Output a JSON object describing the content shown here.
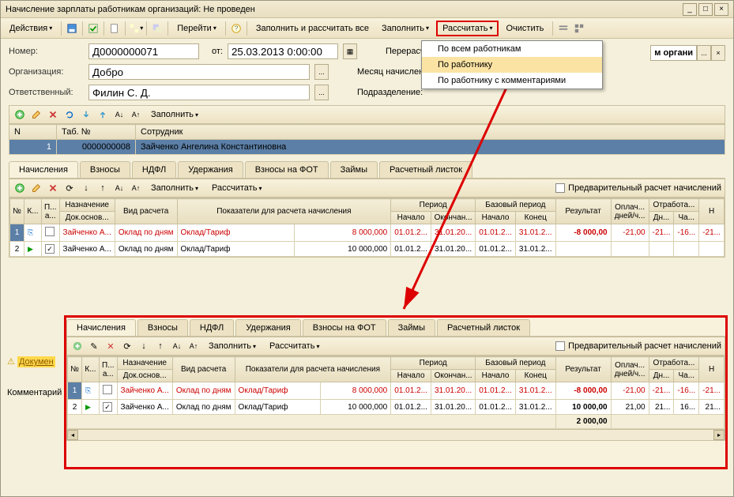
{
  "window": {
    "title": "Начисление зарплаты работникам организаций: Не проведен",
    "min": "_",
    "max": "□",
    "close": "×"
  },
  "toolbar": {
    "actions": "Действия",
    "goto": "Перейти",
    "help": "?",
    "fill_calc_all": "Заполнить и рассчитать все",
    "fill": "Заполнить",
    "calculate": "Рассчитать",
    "clear": "Очистить"
  },
  "menu": {
    "item1": "По всем работникам",
    "item2": "По работнику",
    "item3": "По работнику с комментариями"
  },
  "form": {
    "number_lbl": "Номер:",
    "number": "Д0000000071",
    "from_lbl": "от:",
    "date": "25.03.2013 0:00:00",
    "recalc_lbl": "Перерасчет докум",
    "org_lbl": "Организация:",
    "org": "Добро",
    "month_lbl": "Месяц начисления",
    "resp_lbl": "Ответственный:",
    "resp": "Филин С. Д.",
    "division_lbl": "Подразделение:",
    "org_tag": "м органи",
    "dots": "...",
    "x": "×"
  },
  "emp_toolbar": {
    "fill": "Заполнить"
  },
  "emp_table": {
    "col_n": "N",
    "col_tab": "Таб. №",
    "col_emp": "Сотрудник",
    "n": "1",
    "tab": "0000000008",
    "name": "Зайченко Ангелина Константиновна"
  },
  "tabs": {
    "t1": "Начисления",
    "t2": "Взносы",
    "t3": "НДФЛ",
    "t4": "Удержания",
    "t5": "Взносы на ФОТ",
    "t6": "Займы",
    "t7": "Расчетный листок"
  },
  "grid_toolbar": {
    "fill": "Заполнить",
    "calc": "Рассчитать",
    "prelim": "Предварительный расчет начислений"
  },
  "grid_headers": {
    "n": "№",
    "k": "К...",
    "p": "П... а...",
    "назначение": "Назначение",
    "док": "Док.основ...",
    "вид": "Вид расчета",
    "показатели": "Показатели для расчета начисления",
    "период": "Период",
    "начало": "Начало",
    "окончание": "Окончан...",
    "базовый": "Базовый период",
    "bначало": "Начало",
    "конец": "Конец",
    "результат": "Результат",
    "оплач": "Оплач... дней/ч...",
    "отработа": "Отработа...",
    "дн": "Дн...",
    "ча": "Ча...",
    "н": "Н"
  },
  "grid_rows": [
    {
      "n": "1",
      "designee": "Зайченко А...",
      "type": "Оклад по дням",
      "indicator": "Оклад/Тариф",
      "indval": "8 000,000",
      "pstart": "01.01.2...",
      "pend": "31.01.20...",
      "bstart": "01.01.2...",
      "bend": "31.01.2...",
      "result": "-8 000,00",
      "paid": "-21,00",
      "d": "-21...",
      "h": "-16...",
      "n2": "-21...",
      "red": true,
      "checked": false,
      "flag": ""
    },
    {
      "n": "2",
      "designee": "Зайченко А...",
      "type": "Оклад по дням",
      "indicator": "Оклад/Тариф",
      "indval": "10 000,000",
      "pstart": "01.01.2...",
      "pend": "31.01.20...",
      "bstart": "01.01.2...",
      "bend": "31.01.2...",
      "result": "",
      "paid": "",
      "d": "",
      "h": "",
      "n2": "",
      "red": false,
      "checked": true,
      "flag": "▶"
    }
  ],
  "bottom_rows": [
    {
      "n": "1",
      "designee": "Зайченко А...",
      "type": "Оклад по дням",
      "indicator": "Оклад/Тариф",
      "indval": "8 000,000",
      "pstart": "01.01.2...",
      "pend": "31.01.20...",
      "bstart": "01.01.2...",
      "bend": "31.01.2...",
      "result": "-8 000,00",
      "paid": "-21,00",
      "d": "-21...",
      "h": "-16...",
      "n2": "-21...",
      "red": true
    },
    {
      "n": "2",
      "designee": "Зайченко А...",
      "type": "Оклад по дням",
      "indicator": "Оклад/Тариф",
      "indval": "10 000,000",
      "pstart": "01.01.2...",
      "pend": "31.01.20...",
      "bstart": "01.01.2...",
      "bend": "31.01.2...",
      "result": "10 000,00",
      "paid": "21,00",
      "d": "21...",
      "h": "16...",
      "n2": "21...",
      "red": false
    }
  ],
  "total": "2 000,00",
  "side": {
    "docs": "Докумен",
    "comment": "Комментарий"
  }
}
